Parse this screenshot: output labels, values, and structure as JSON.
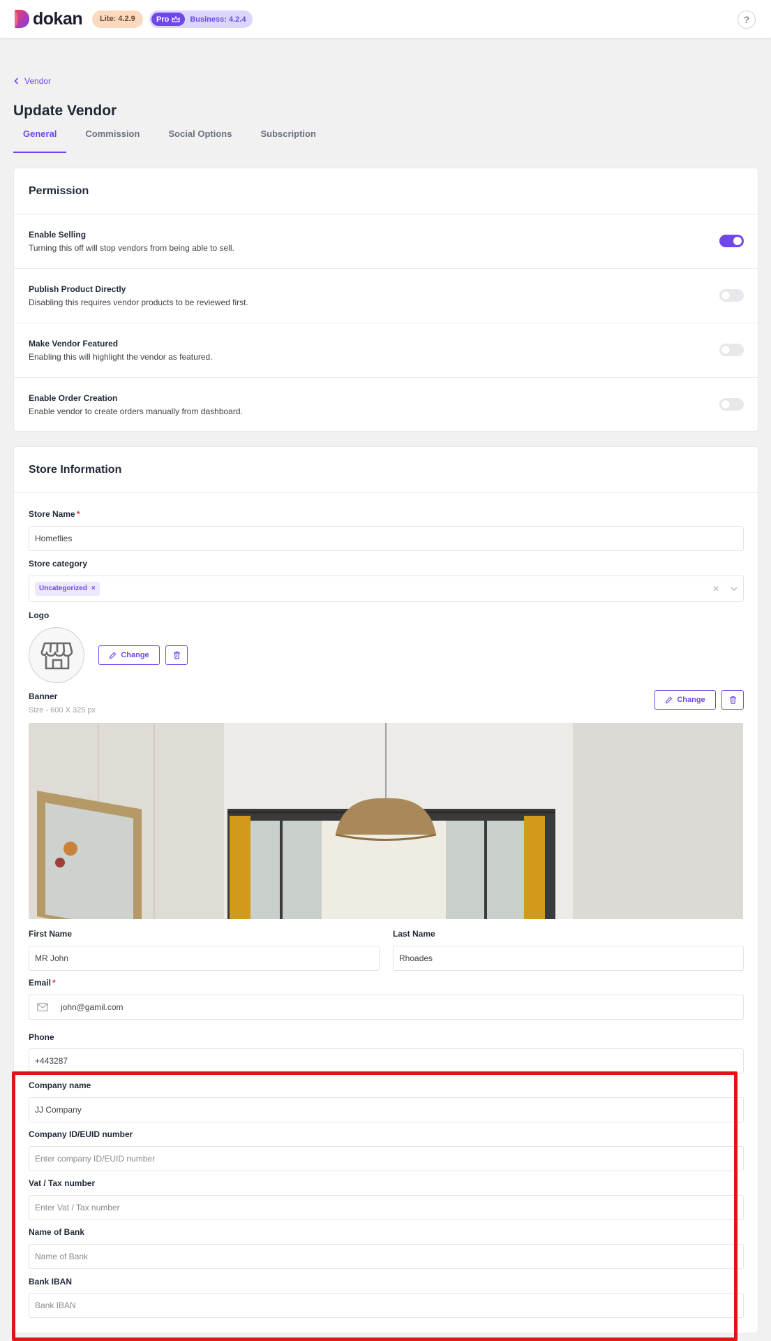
{
  "header": {
    "brand": "dokan",
    "lite_badge": "Lite: 4.2.9",
    "pro_badge": "Pro",
    "business_badge": "Business: 4.2.4",
    "help": "?"
  },
  "breadcrumb": {
    "back_label": "Vendor"
  },
  "page": {
    "title": "Update Vendor"
  },
  "tabs": [
    {
      "label": "General",
      "active": true
    },
    {
      "label": "Commission"
    },
    {
      "label": "Social Options"
    },
    {
      "label": "Subscription"
    }
  ],
  "permission": {
    "title": "Permission",
    "items": [
      {
        "title": "Enable Selling",
        "desc": "Turning this off will stop vendors from being able to sell.",
        "enabled": true
      },
      {
        "title": "Publish Product Directly",
        "desc": "Disabling this requires vendor products to be reviewed first.",
        "enabled": false
      },
      {
        "title": "Make Vendor Featured",
        "desc": "Enabling this will highlight the vendor as featured.",
        "enabled": false
      },
      {
        "title": "Enable Order Creation",
        "desc": "Enable vendor to create orders manually from dashboard.",
        "enabled": false
      }
    ]
  },
  "store": {
    "title": "Store Information",
    "store_name_label": "Store Name",
    "required_mark": "*",
    "store_name_value": "Homeflies",
    "category_label": "Store category",
    "category_chip": "Uncategorized",
    "chip_remove": "×",
    "clear_icon": "✕",
    "logo_label": "Logo",
    "change_label": "Change",
    "banner_label": "Banner",
    "banner_size": "Size - 600 X 325 px",
    "first_name_label": "First Name",
    "first_name_value": "MR John",
    "last_name_label": "Last Name",
    "last_name_value": "Rhoades",
    "email_label": "Email",
    "email_value": "john@gamil.com",
    "phone_label": "Phone",
    "phone_value": "+443287",
    "company_name_label": "Company name",
    "company_name_value": "JJ Company",
    "company_id_label": "Company ID/EUID number",
    "company_id_placeholder": "Enter company ID/EUID number",
    "vat_label": "Vat / Tax number",
    "vat_placeholder": "Enter Vat / Tax number",
    "bank_name_label": "Name of Bank",
    "bank_name_placeholder": "Name of Bank",
    "iban_label": "Bank IBAN",
    "iban_placeholder": "Bank IBAN"
  },
  "colors": {
    "accent": "#7047eb",
    "highlight": "#e01414",
    "required": "#e0303a"
  }
}
